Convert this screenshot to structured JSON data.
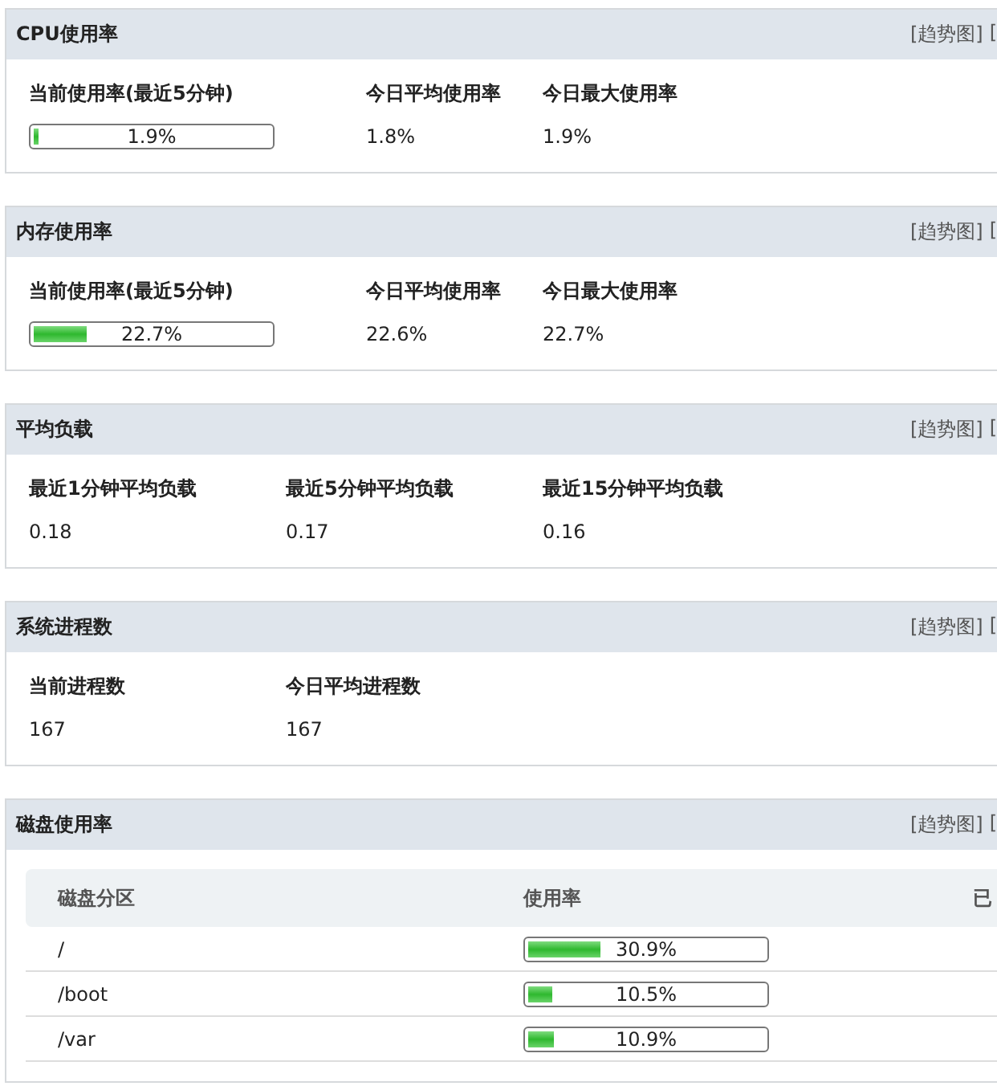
{
  "sections": [
    {
      "title": "CPU使用率",
      "kind": "usage",
      "links": [
        "[趋势图]",
        "["
      ],
      "stats": [
        {
          "label": "当前使用率(最近5分钟)",
          "value": "1.9%",
          "kind": "bar",
          "level": 0.019
        },
        {
          "label": "今日平均使用率",
          "value": "1.8%",
          "kind": "text"
        },
        {
          "label": "今日最大使用率",
          "value": "1.9%",
          "kind": "text"
        }
      ]
    },
    {
      "title": "内存使用率",
      "kind": "usage",
      "links": [
        "[趋势图]",
        "["
      ],
      "stats": [
        {
          "label": "当前使用率(最近5分钟)",
          "value": "22.7%",
          "kind": "bar",
          "level": 0.227
        },
        {
          "label": "今日平均使用率",
          "value": "22.6%",
          "kind": "text"
        },
        {
          "label": "今日最大使用率",
          "value": "22.7%",
          "kind": "text"
        }
      ]
    },
    {
      "title": "平均负载",
      "kind": "counts",
      "links": [
        "[趋势图]",
        "["
      ],
      "stats": [
        {
          "label": "最近1分钟平均负载",
          "value": "0.18",
          "kind": "text"
        },
        {
          "label": "最近5分钟平均负载",
          "value": "0.17",
          "kind": "text"
        },
        {
          "label": "最近15分钟平均负载",
          "value": "0.16",
          "kind": "text"
        }
      ]
    },
    {
      "title": "系统进程数",
      "kind": "counts",
      "links": [
        "[趋势图]",
        "["
      ],
      "stats": [
        {
          "label": "当前进程数",
          "value": "167",
          "kind": "text"
        },
        {
          "label": "今日平均进程数",
          "value": "167",
          "kind": "text"
        }
      ]
    },
    {
      "title": "磁盘使用率",
      "kind": "table",
      "links": [
        "[趋势图]",
        "["
      ],
      "columns": [
        "磁盘分区",
        "使用率",
        "已"
      ],
      "rows": [
        {
          "partition": "/",
          "usage": "30.9%",
          "level": 0.309
        },
        {
          "partition": "/boot",
          "usage": "10.5%",
          "level": 0.105
        },
        {
          "partition": "/var",
          "usage": "10.9%",
          "level": 0.109
        }
      ]
    }
  ]
}
